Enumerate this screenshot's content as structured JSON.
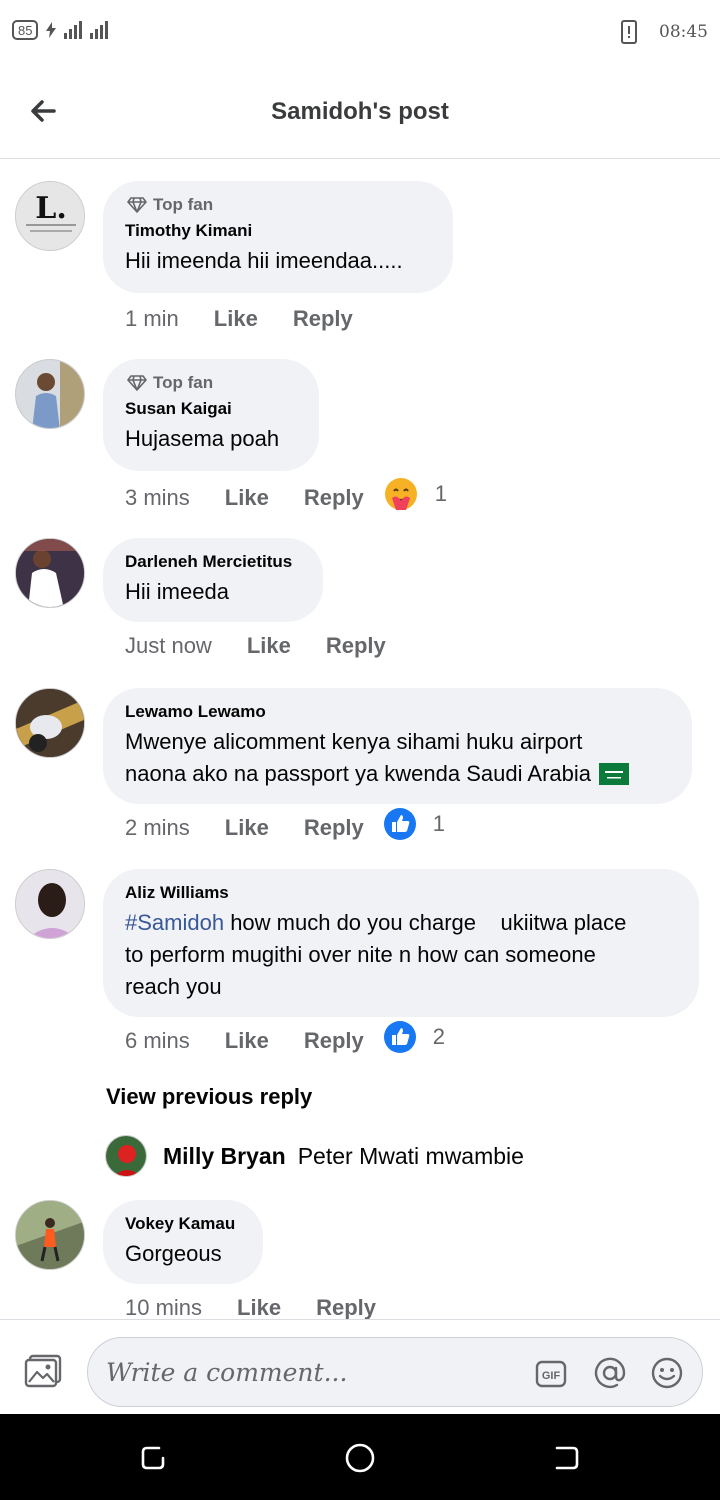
{
  "status_bar": {
    "battery": "85",
    "time": "08:45"
  },
  "header": {
    "title": "Samidoh's post"
  },
  "comments": [
    {
      "badge": "Top fan",
      "author": "Timothy Kimani",
      "text": "Hii imeenda hii imeendaa.....",
      "time": "1 min",
      "like": "Like",
      "reply": "Reply"
    },
    {
      "badge": "Top fan",
      "author": "Susan Kaigai",
      "text": "Hujasema poah",
      "time": "3 mins",
      "like": "Like",
      "reply": "Reply",
      "reaction": "care-emoji",
      "reaction_count": "1"
    },
    {
      "author": "Darleneh Mercietitus",
      "text": "Hii imeeda",
      "time": "Just now",
      "like": "Like",
      "reply": "Reply"
    },
    {
      "author": "Lewamo Lewamo",
      "text_line1": "Mwenye alicomment kenya sihami huku airport",
      "text_line2": "naona ako na passport ya kwenda Saudi Arabia",
      "time": "2 mins",
      "like": "Like",
      "reply": "Reply",
      "reaction": "like-emoji",
      "reaction_count": "1"
    },
    {
      "author": "Aliz Williams",
      "hashtag": "#Samidoh",
      "text_line1": " how much do you charge    ukiitwa place",
      "text_line2": "to perform mugithi over nite n how can someone",
      "text_line3": "reach you",
      "time": "6 mins",
      "like": "Like",
      "reply": "Reply",
      "reaction": "like-emoji",
      "reaction_count": "2"
    },
    {
      "author": "Vokey Kamau",
      "text": "Gorgeous",
      "time": "10 mins",
      "like": "Like",
      "reply": "Reply"
    }
  ],
  "view_previous": "View previous reply",
  "nested_reply": {
    "author": "Milly Bryan",
    "text": "Peter Mwati mwambie"
  },
  "composer": {
    "placeholder": "Write a comment..."
  },
  "colors": {
    "bubble": "#f0f2f5",
    "meta": "#65676b",
    "like_blue": "#1877f2",
    "hashtag": "#385898"
  }
}
